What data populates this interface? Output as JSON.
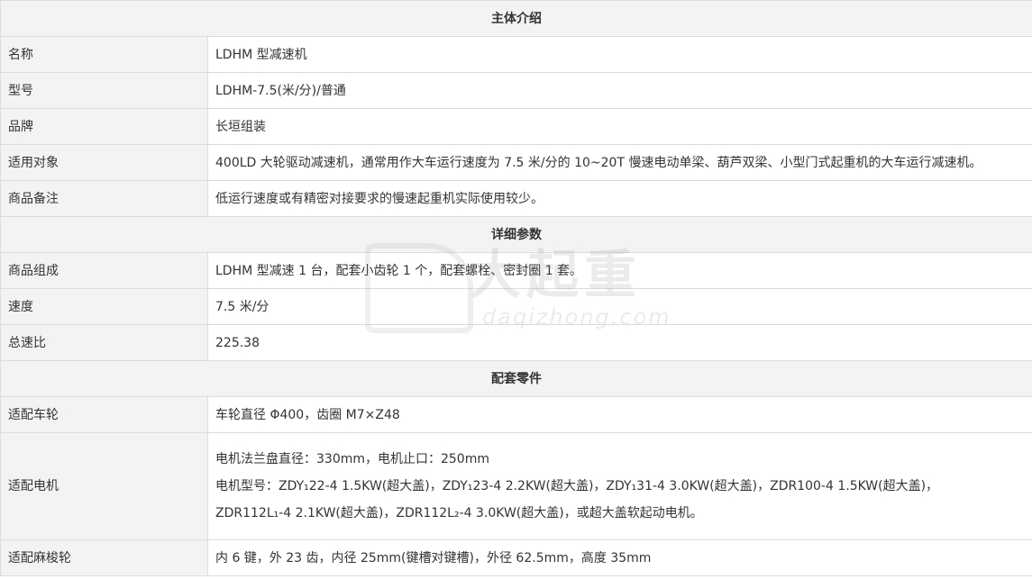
{
  "sections": [
    {
      "title": "主体介绍",
      "rows": [
        {
          "label": "名称",
          "value": "LDHM 型减速机"
        },
        {
          "label": "型号",
          "value": "LDHM-7.5(米/分)/普通"
        },
        {
          "label": "品牌",
          "value": "长垣组装"
        },
        {
          "label": "适用对象",
          "value": "400LD 大轮驱动减速机，通常用作大车运行速度为 7.5 米/分的 10~20T 慢速电动单梁、葫芦双梁、小型门式起重机的大车运行减速机。"
        },
        {
          "label": "商品备注",
          "value": "低运行速度或有精密对接要求的慢速起重机实际使用较少。"
        }
      ]
    },
    {
      "title": "详细参数",
      "rows": [
        {
          "label": "商品组成",
          "value": "LDHM 型减速 1 台，配套小齿轮 1 个，配套螺栓、密封圈 1 套。"
        },
        {
          "label": "速度",
          "value": "7.5 米/分"
        },
        {
          "label": "总速比",
          "value": "225.38"
        }
      ]
    },
    {
      "title": "配套零件",
      "rows": [
        {
          "label": "适配车轮",
          "value": "车轮直径 Φ400，齿圈 M7×Z48"
        },
        {
          "label": "适配电机",
          "lines": [
            "电机法兰盘直径：330mm，电机止口：250mm",
            "电机型号：ZDY₁22-4    1.5KW(超大盖)，ZDY₁23-4    2.2KW(超大盖)，ZDY₁31-4    3.0KW(超大盖)，ZDR100-4    1.5KW(超大盖)，",
            "ZDR112L₁-4    2.1KW(超大盖)，ZDR112L₂-4    3.0KW(超大盖)，或超大盖软起动电机。"
          ]
        },
        {
          "label": "适配麻梭轮",
          "value": "内 6 键，外 23 齿，内径 25mm(键槽对键槽)，外径 62.5mm，高度 35mm"
        }
      ]
    }
  ],
  "watermark": {
    "cn": "大起重",
    "en": "daqizhong.com"
  }
}
